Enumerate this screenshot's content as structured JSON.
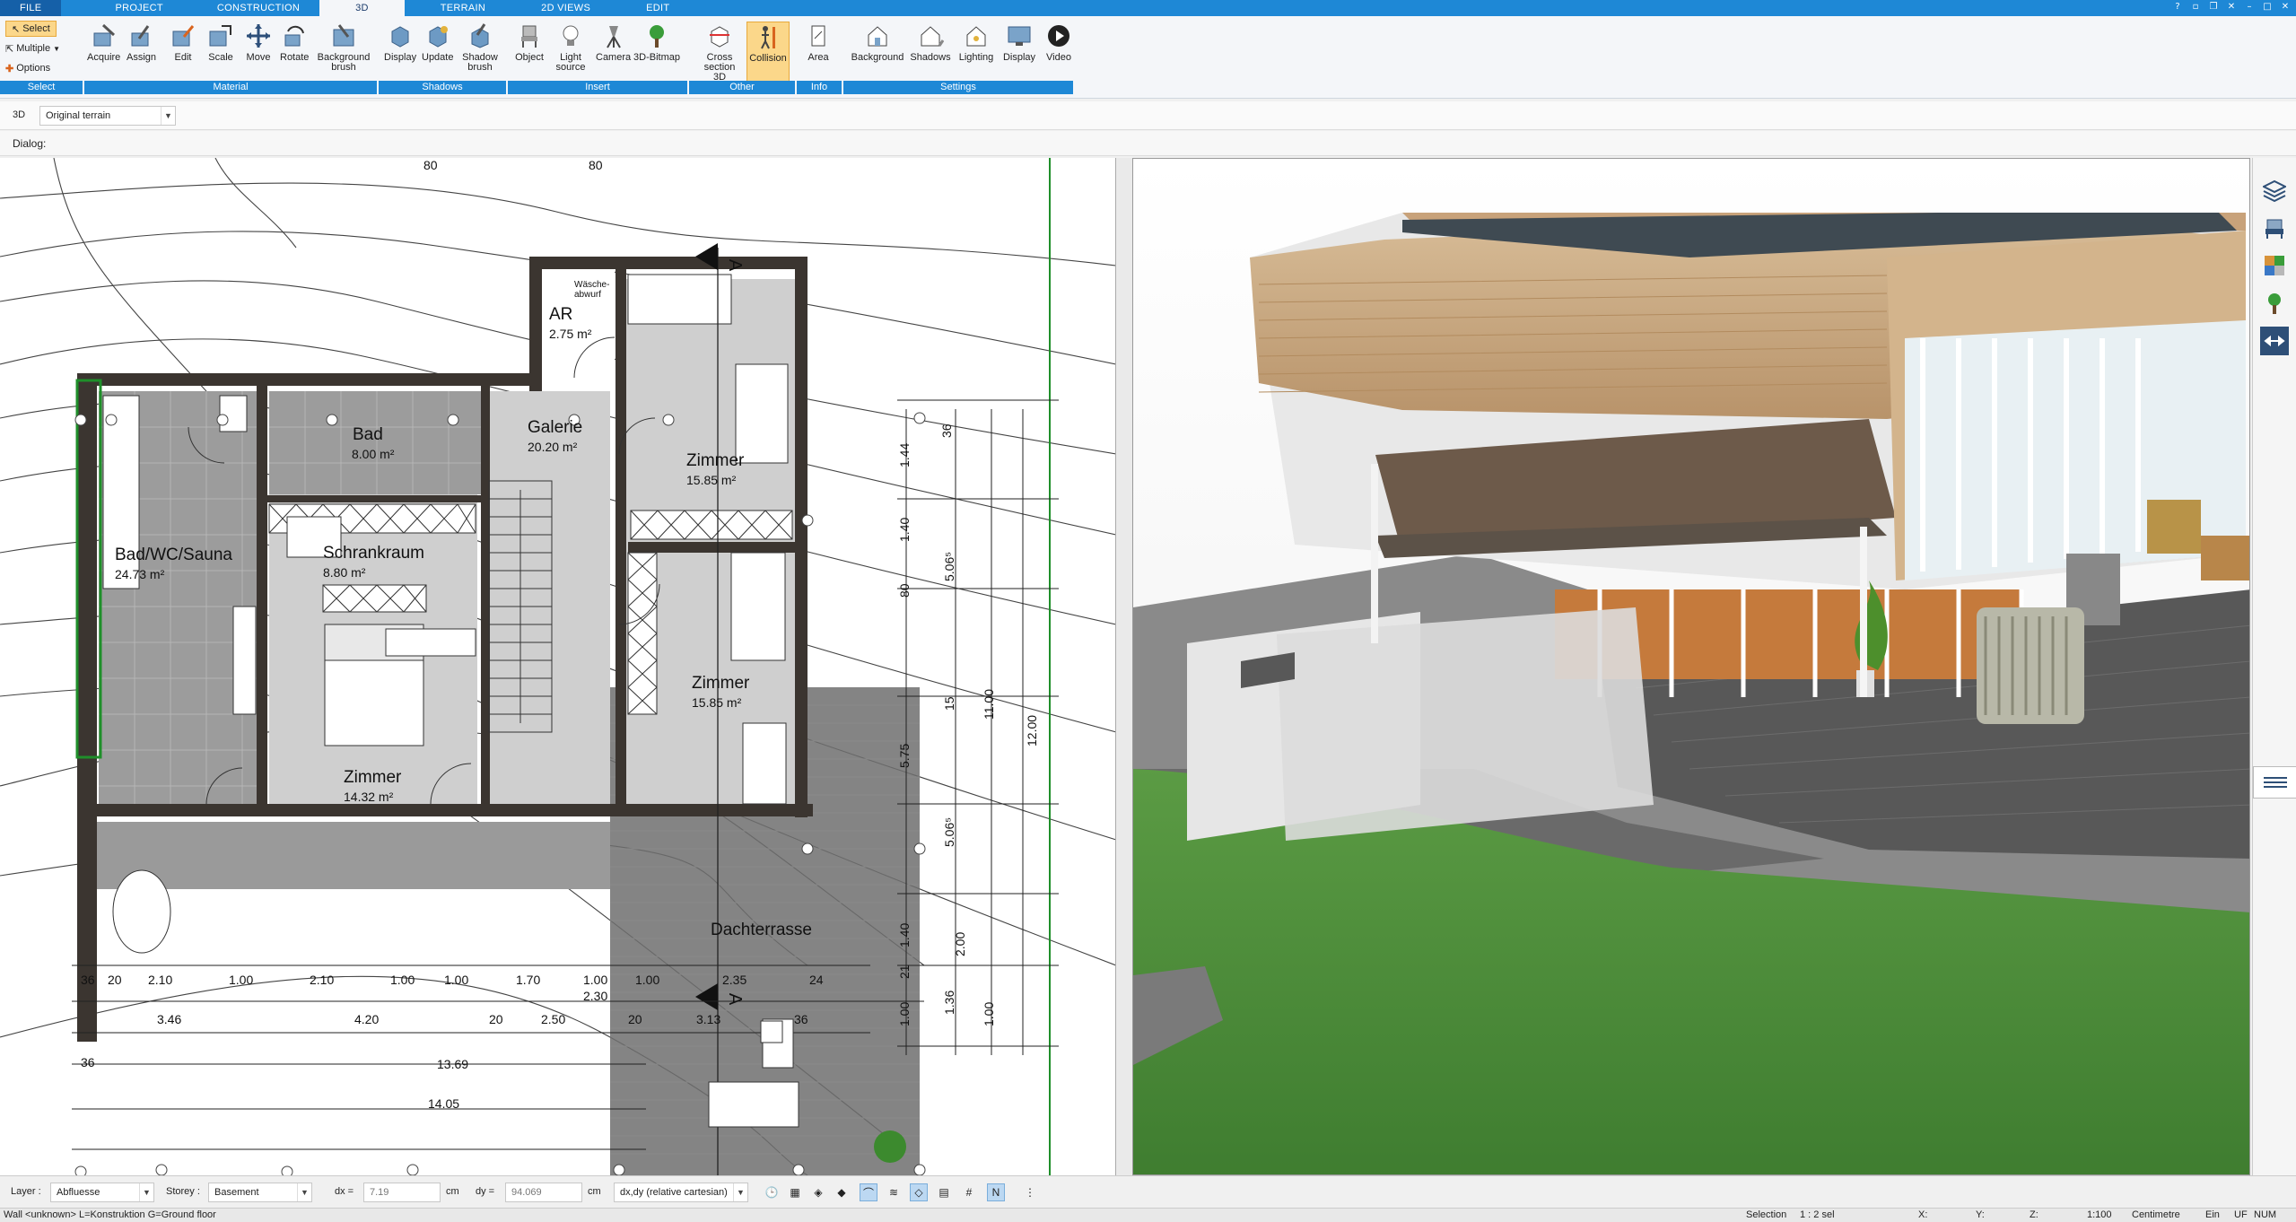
{
  "menu": {
    "tabs": [
      "FILE",
      "PROJECT",
      "CONSTRUCTION",
      "3D",
      "TERRAIN",
      "2D VIEWS",
      "EDIT"
    ],
    "active": "3D"
  },
  "ribbon": {
    "select_group": {
      "select": "Select",
      "multiple": "Multiple",
      "options": "Options",
      "label": "Select"
    },
    "material": {
      "label": "Material",
      "buttons": [
        "Acquire",
        "Assign",
        "Edit",
        "Scale",
        "Move",
        "Rotate",
        "Background brush"
      ]
    },
    "shadows": {
      "label": "Shadows",
      "buttons": [
        "Display",
        "Update",
        "Shadow brush"
      ]
    },
    "insert": {
      "label": "Insert",
      "buttons": [
        "Object",
        "Light source",
        "Camera",
        "3D-Bitmap"
      ]
    },
    "other": {
      "label": "Other",
      "buttons": [
        "Cross section 3D",
        "Collision"
      ]
    },
    "info": {
      "label": "Info",
      "buttons": [
        "Area"
      ]
    },
    "settings": {
      "label": "Settings",
      "buttons": [
        "Background",
        "Shadows",
        "Lighting",
        "Display",
        "Video"
      ]
    }
  },
  "toolbar": {
    "view_mode": "3D",
    "terrain_select": "Original terrain",
    "dialog_label": "Dialog:"
  },
  "plan": {
    "rooms": [
      {
        "name": "AR",
        "area": "2.75 m²"
      },
      {
        "name": "Bad",
        "area": "8.00 m²"
      },
      {
        "name": "Galerie",
        "area": "20.20 m²"
      },
      {
        "name": "Zimmer",
        "area": "15.85 m²"
      },
      {
        "name": "Bad/WC/Sauna",
        "area": "24.73 m²"
      },
      {
        "name": "Schrankraum",
        "area": "8.80 m²"
      },
      {
        "name": "Zimmer",
        "area": "15.85 m²"
      },
      {
        "name": "Zimmer",
        "area": "14.32 m²"
      },
      {
        "name": "Dachterrasse",
        "area": ""
      }
    ],
    "small_label": "Wäsche-abwurf",
    "section_marker": "A",
    "top_dims": [
      "80",
      "80"
    ],
    "bottom_dims_row1": [
      "36",
      "20",
      "2.10",
      "1.00",
      "2.10",
      "1.00",
      "1.00",
      "1.70",
      "1.00",
      "1.00",
      "2.35",
      "24"
    ],
    "bottom_dims_row2": [
      "3.46",
      "4.20",
      "20",
      "2.50",
      "20",
      "3.13",
      "36"
    ],
    "bottom_dims_extra": "2.30",
    "bottom_dims_row3": [
      "36",
      "13.69"
    ],
    "bottom_dims_row4": "14.05",
    "right_dims": [
      "36",
      "1.44",
      "1.40",
      "80",
      "5.06⁵",
      "15",
      "5.75",
      "11.00",
      "12.00",
      "5.06⁵",
      "1.40",
      "2.00",
      "21",
      "1.00",
      "1.36",
      "1.00"
    ]
  },
  "status": {
    "layer_label": "Layer :",
    "layer_value": "Abfluesse",
    "storey_label": "Storey :",
    "storey_value": "Basement",
    "dx_label": "dx =",
    "dx_value": "7.19",
    "dy_label": "dy =",
    "dy_value": "94.069",
    "unit": "cm",
    "coord_mode": "dx,dy (relative cartesian)"
  },
  "bottom": {
    "hint": "Wall <unknown> L=Konstruktion G=Ground floor",
    "selection": "Selection",
    "selection_count": "1 : 2 sel",
    "x": "X:",
    "y": "Y:",
    "z": "Z:",
    "scale": "1:100",
    "unit": "Centimetre",
    "ein": "Ein",
    "uf": "UF",
    "num": "NUM"
  },
  "colors": {
    "ribbon_blue": "#1e88d6",
    "select_highlight": "#fbd78a",
    "grass": "#4b8a3a",
    "wood": "#c9a77f"
  }
}
